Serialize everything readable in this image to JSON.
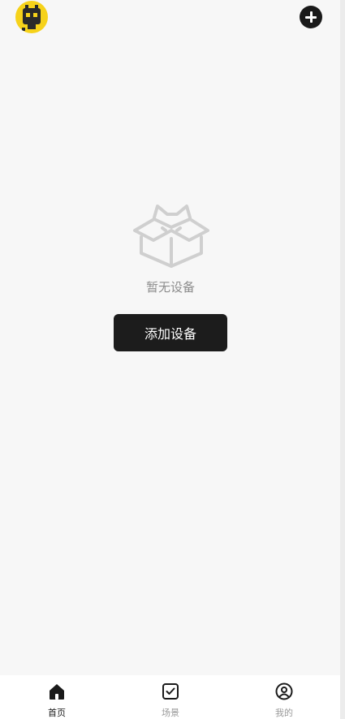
{
  "header": {
    "avatar_icon": "robot-avatar-icon",
    "add_icon": "plus-circle-icon"
  },
  "empty_state": {
    "illustration_icon": "empty-box-cat-icon",
    "message": "暂无设备",
    "button_label": "添加设备"
  },
  "tabbar": {
    "items": [
      {
        "label": "首页",
        "icon": "home-icon",
        "active": true
      },
      {
        "label": "场景",
        "icon": "checkbox-icon",
        "active": false
      },
      {
        "label": "我的",
        "icon": "user-circle-icon",
        "active": false
      }
    ]
  },
  "colors": {
    "background": "#f7f7f7",
    "primary_dark": "#1c1c1c",
    "avatar_yellow": "#f6d21a",
    "muted_text": "#8c8c8c"
  }
}
